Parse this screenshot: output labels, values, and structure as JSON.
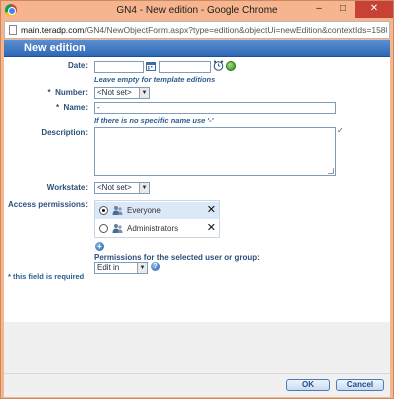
{
  "window": {
    "title": "GN4 - New edition - Google Chrome",
    "minimize": "–",
    "maximize": "□",
    "close": "✕"
  },
  "address": {
    "host": "main.teradp.com",
    "path": "/GN4/NewObjectForm.aspx?type=edition&objectUi=newEdition&contextIds=1588&dlg=1&webP..."
  },
  "header": {
    "title": "New edition"
  },
  "form": {
    "date": {
      "label": "Date:",
      "value1": "",
      "value2": "",
      "hint": "Leave empty for template editions",
      "icons": [
        "clock-icon",
        "refresh-icon"
      ]
    },
    "number": {
      "req": "*",
      "label": "Number:",
      "selected": "<Not set>"
    },
    "name": {
      "req": "*",
      "label": "Name:",
      "value": "-",
      "hint": "If there is no specific name use '-'"
    },
    "description": {
      "label": "Description:",
      "value": "",
      "spell_icon": "spellcheck-icon"
    },
    "workstate": {
      "label": "Workstate:",
      "selected": "<Not set>"
    },
    "access": {
      "label": "Access permissions:",
      "entries": [
        {
          "name": "Everyone",
          "selected": true
        },
        {
          "name": "Administrators",
          "selected": false
        }
      ],
      "perm_label": "Permissions for the selected user or group:",
      "perm_selected": "Edit in"
    },
    "required_note": "* this field is required"
  },
  "buttons": {
    "ok": "OK",
    "cancel": "Cancel"
  },
  "colors": {
    "header": "#2f68b6",
    "label": "#2d4f7a",
    "frame": "#f6b58f",
    "close": "#c74234"
  }
}
